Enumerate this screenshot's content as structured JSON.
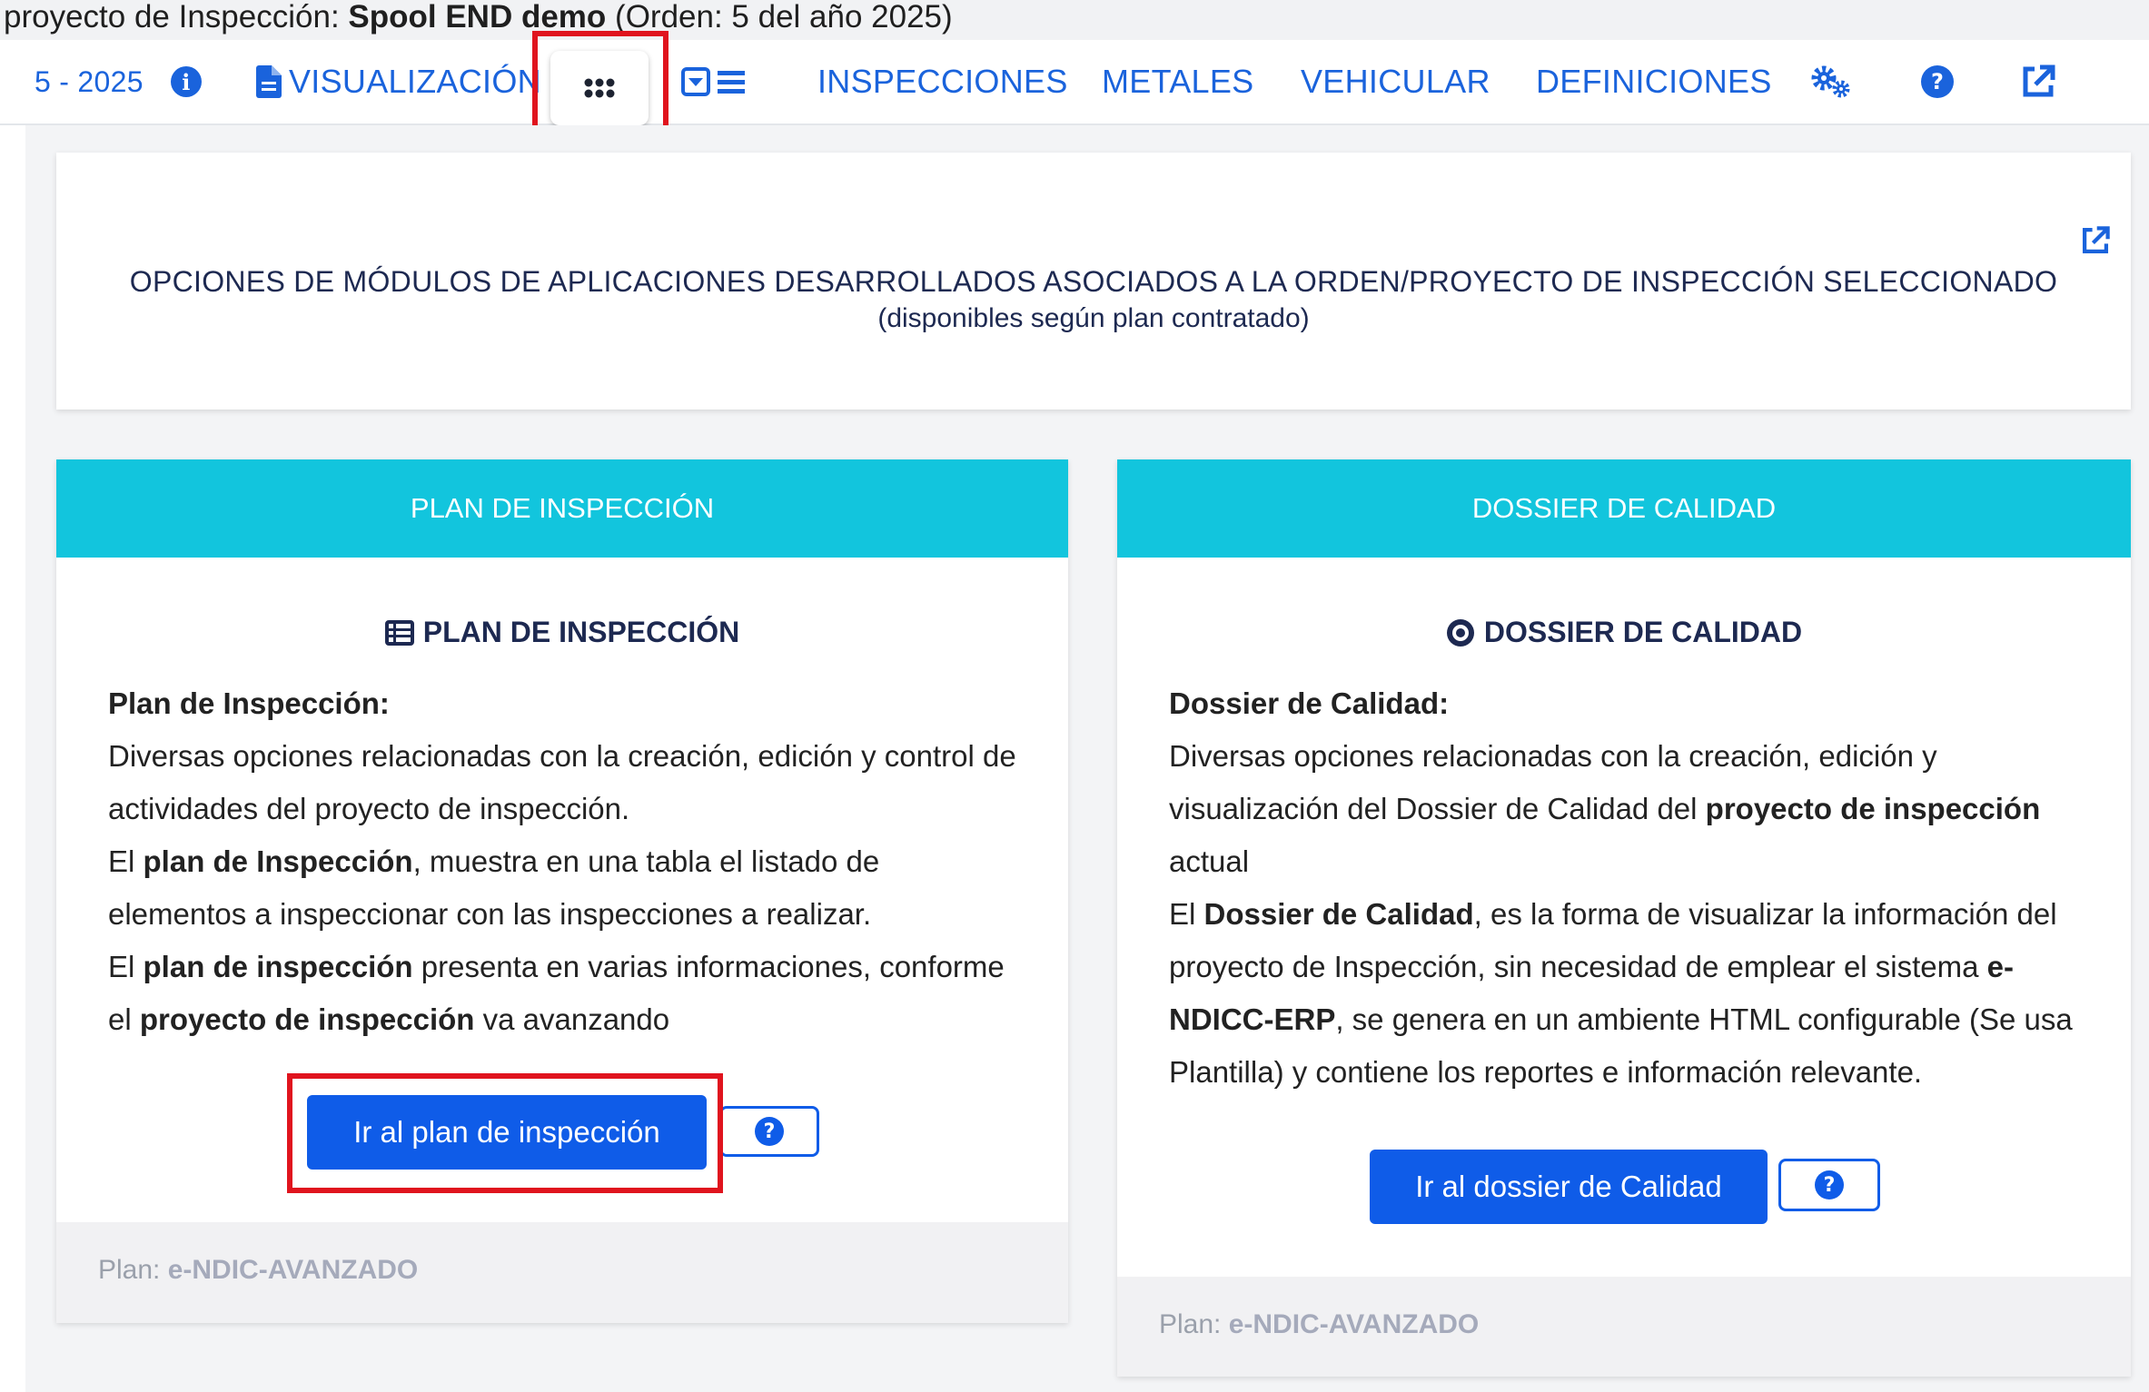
{
  "header": {
    "prefix": "proyecto de Inspección: ",
    "project_name": "Spool END demo",
    "order_info": " (Orden: 5 del año 2025)"
  },
  "nav": {
    "order_label": "5 - 2025",
    "visualizacion": "VISUALIZACIÓN",
    "inspecciones": "INSPECCIONES",
    "metales": "METALES",
    "vehicular": "VEHICULAR",
    "definiciones": "DEFINICIONES"
  },
  "intro": {
    "title": "OPCIONES DE MÓDULOS DE APLICACIONES DESARROLLADOS ASOCIADOS A LA ORDEN/PROYECTO DE INSPECCIÓN SELECCIONADO",
    "subtitle": "(disponibles según plan contratado)"
  },
  "cards": [
    {
      "header": "PLAN DE INSPECCIÓN",
      "title": "PLAN DE INSPECCIÓN",
      "icon": "table-list-icon",
      "heading": "Plan de Inspección:",
      "line1": "Diversas opciones relacionadas con la creación, edición y control de actividades del proyecto de inspección.",
      "l2_a": "El ",
      "l2_b": "plan de Inspección",
      "l2_c": ", muestra en una tabla el listado de elementos a inspeccionar con las inspecciones a realizar.",
      "l3_a": "El ",
      "l3_b": "plan de inspección",
      "l3_c": " presenta en varias informaciones, conforme el ",
      "l3_d": "proyecto de inspección",
      "l3_e": " va avanzando",
      "button": "Ir al plan de inspección",
      "footer_label": "Plan: ",
      "footer_value": "e-NDIC-AVANZADO"
    },
    {
      "header": "DOSSIER DE CALIDAD",
      "title": "DOSSIER DE CALIDAD",
      "icon": "record-circle-icon",
      "heading": "Dossier de Calidad:",
      "l1_a": "Diversas opciones relacionadas con la creación, edición y visualización del Dossier de Calidad del ",
      "l1_b": "proyecto de inspección",
      "l1_c": " actual",
      "l2_a": "El ",
      "l2_b": "Dossier de Calidad",
      "l2_c": ", es la forma de visualizar la información del proyecto de Inspección, sin necesidad de emplear el sistema ",
      "l2_d": "e-NDICC-ERP",
      "l2_e": ", se genera en un ambiente HTML configurable (Se usa Plantilla) y contiene los reportes e información relevante.",
      "button": "Ir al dossier de Calidad",
      "footer_label": "Plan: ",
      "footer_value": "e-NDIC-AVANZADO"
    }
  ],
  "colors": {
    "accent": "#12c5dd",
    "primary": "#0f5ce8",
    "link": "#1a63dc",
    "highlight": "#e0141e"
  }
}
